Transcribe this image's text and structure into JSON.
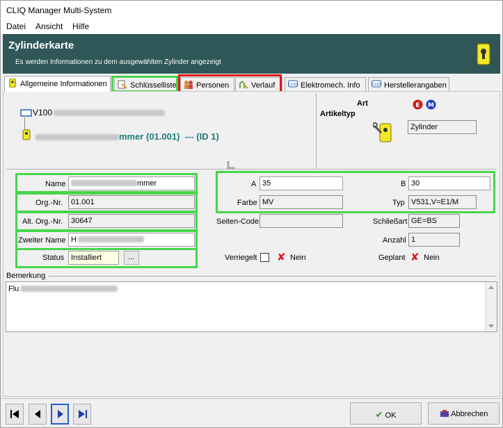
{
  "window": {
    "title": "CLIQ Manager Multi-System"
  },
  "menu": [
    "Datei",
    "Ansicht",
    "Hilfe"
  ],
  "header": {
    "title": "Zylinderkarte",
    "subtitle": "Es werden Informationen zu dem ausgewählten Zylinder angezeigt"
  },
  "tabs": [
    {
      "label": "Allgemeine Informationen",
      "icon": "key-icon",
      "active": true
    },
    {
      "label": "Schlüsselliste",
      "icon": "keys-list-icon"
    },
    {
      "label": "Personen",
      "icon": "persons-icon"
    },
    {
      "label": "Verlauf",
      "icon": "history-icon"
    },
    {
      "label": "Elektromech. Info",
      "icon": "cliq-icon"
    },
    {
      "label": "Herstellerangaben",
      "icon": "cliq-icon"
    }
  ],
  "tree": {
    "root_prefix": "V100",
    "cylinder_suffix": "mmer (01.001)",
    "cylinder_id": "---  (ID 1)"
  },
  "art": {
    "art_label": "Art",
    "artikeltyp_label": "Artikeltyp",
    "artikeltyp_value": "Zylinder"
  },
  "form": {
    "name_label": "Name",
    "name_suffix": "mmer",
    "org_label": "Org.-Nr.",
    "org_value": "01.001",
    "altorg_label": "Alt. Org.-Nr.",
    "altorg_value": "30647",
    "zweiter_label": "Zweiter Name",
    "zweiter_prefix": "H",
    "status_label": "Status",
    "status_value": "Installiert",
    "status_btn": "...",
    "a_label": "A",
    "a_value": "35",
    "b_label": "B",
    "b_value": "30",
    "farbe_label": "Farbe",
    "farbe_value": "MV",
    "typ_label": "Typ",
    "typ_value": "V531,V=E1/M",
    "seiten_label": "Seiten-Code",
    "seiten_value": "",
    "schliess_label": "Schließart",
    "schliess_value": "GE=BS",
    "anzahl_label": "Anzahl",
    "anzahl_value": "1",
    "verriegelt_label": "Verriegelt",
    "verriegelt_value": "Nein",
    "geplant_label": "Geplant",
    "geplant_value": "Nein"
  },
  "bemerkung": {
    "label": "Bemerkung",
    "prefix": "Flu"
  },
  "footer": {
    "ok": "OK",
    "cancel": "Abbrechen"
  },
  "colors": {
    "header_bg": "#2f5757",
    "highlight_green": "#46d64b",
    "highlight_red": "#e0141b",
    "link_teal": "#1f7a7a"
  }
}
